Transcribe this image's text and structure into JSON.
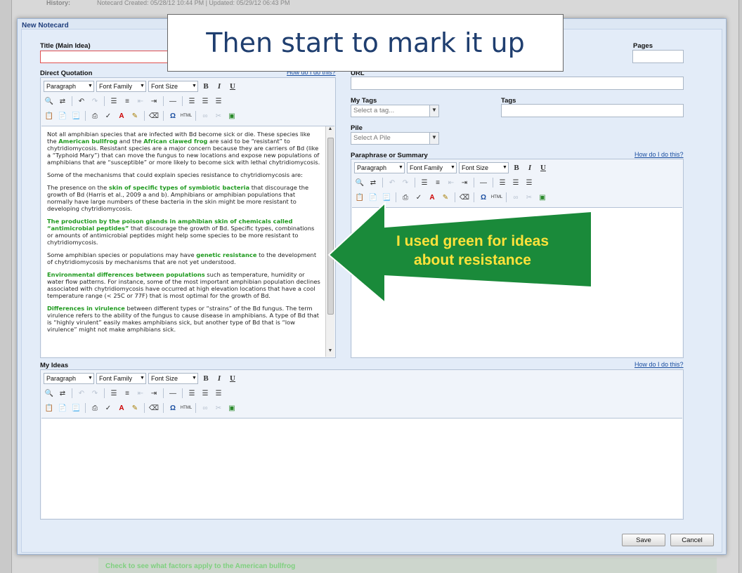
{
  "history": {
    "label": "History:",
    "text": "Notecard Created: 05/28/12 10:44 PM | Updated: 05/29/12 06:43 PM"
  },
  "dialog": {
    "title": "New Notecard",
    "fields": {
      "title_label": "Title (Main Idea)",
      "pages_label": "Pages",
      "direct_quotation_label": "Direct Quotation",
      "url_label": "URL",
      "my_tags_label": "My Tags",
      "my_tags_placeholder": "Select a tag...",
      "tags_label": "Tags",
      "pile_label": "Pile",
      "pile_placeholder": "Select A Pile",
      "paraphrase_label": "Paraphrase or Summary",
      "my_ideas_label": "My Ideas",
      "help_link": "How do I do this?"
    },
    "toolbar": {
      "paragraph": "Paragraph",
      "font_family": "Font Family",
      "font_size": "Font Size",
      "bold": "B",
      "italic": "I",
      "underline": "U"
    },
    "quotation": {
      "p1": {
        "t1": "Not all amphibian species that are infected with Bd become sick or die. These species like the ",
        "g1": "American bullfrog",
        "t2": " and the ",
        "g2": "African clawed frog",
        "t3": " are said to be “resistant” to chytridiomycosis. Resistant species are a major concern because they are carriers of Bd (like a “Typhoid Mary”) that can move the fungus to new locations and expose new populations of amphibians that are “susceptible” or more likely to become sick with lethal chytridiomycosis."
      },
      "p2": "Some of the mechanisms that could explain species resistance to chytridiomycosis are:",
      "p3": {
        "t1": "The presence on the ",
        "g1": "skin of specific types of symbiotic bacteria",
        "t2": " that discourage the growth of Bd (Harris et al., 2009 a and b). Amphibians or amphibian populations that normally have large numbers of these bacteria in the skin might be more resistant to developing chytridiomycosis."
      },
      "p4": {
        "g1": "The production by the poison glands in amphibian skin of chemicals called “antimicrobial peptides”",
        "t1": " that discourage the growth of Bd. Specific types, combinations or amounts of antimicrobial peptides might help some species to be more resistant to chytridiomycosis."
      },
      "p5": {
        "t1": "Some amphibian species or populations may have ",
        "g1": "genetic resistance",
        "t2": " to the development of chytridiomycosis by mechanisms that are not yet understood."
      },
      "p6": {
        "g1": "Environmental differences between populations",
        "t1": " such as temperature, humidity or water flow patterns. For instance, some of the most important amphibian population declines associated with chytridiomycosis have occurred at high elevation locations that have a cool temperature range (< 25C or 77F) that is most optimal for the growth of Bd."
      },
      "p7": {
        "g1": "Differences in virulence",
        "t1": " between different types or “strains” of the Bd fungus. The term virulence refers to the ability of the fungus to cause disease in amphibians. A type of Bd that is “highly virulent” easily makes amphibians sick, but another type of Bd that is “low virulence” might not make amphibians sick."
      }
    },
    "buttons": {
      "save": "Save",
      "cancel": "Cancel"
    }
  },
  "bottom_link": "Check to see what factors apply to the American bullfrog",
  "callout_text": "Then start to mark it up",
  "arrow_text": "I used green for ideas about resistance",
  "colors": {
    "highlight_green": "#1f9a1f",
    "arrow_green": "#1a8a3a",
    "arrow_text": "#ffe23a",
    "callout_text": "#1f3e6f"
  }
}
